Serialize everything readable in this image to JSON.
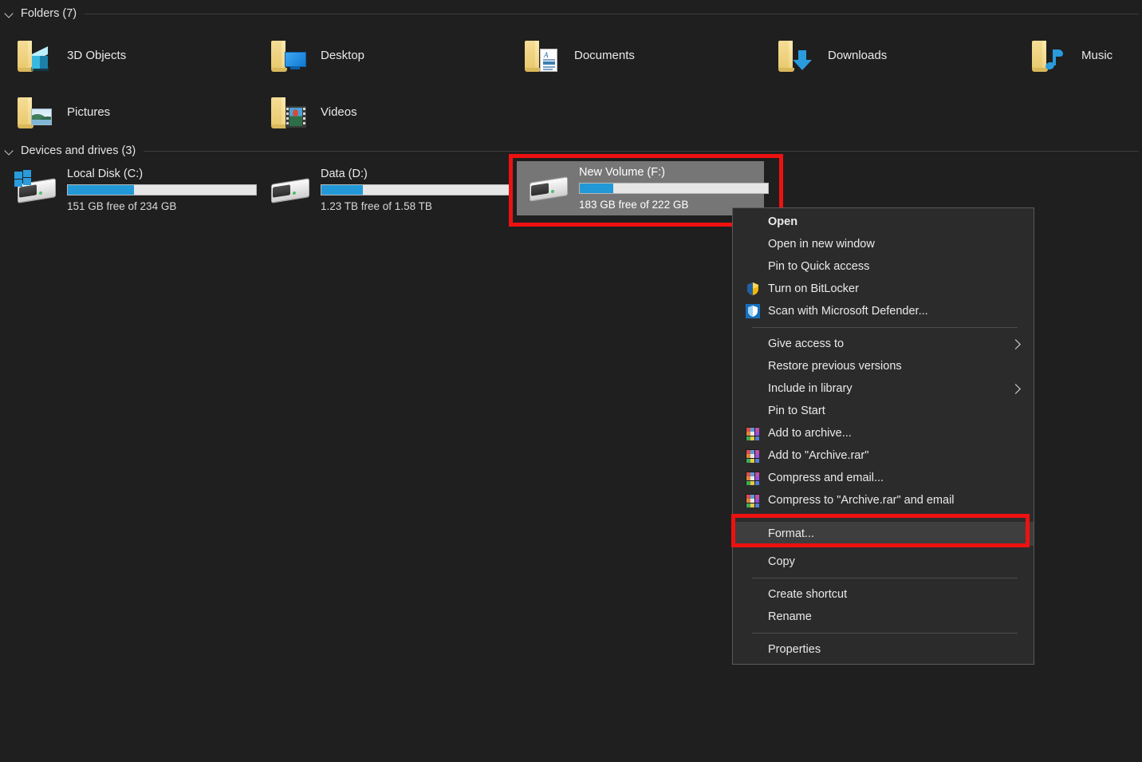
{
  "window": {
    "background_color": "#1f1f1f",
    "accent_color": "#2398d6",
    "annotation_color": "#ee1111"
  },
  "sections": [
    {
      "id": "folders",
      "title": "Folders (7)",
      "chevron_icon": "chevron-down-icon"
    },
    {
      "id": "devices",
      "title": "Devices and drives (3)",
      "chevron_icon": "chevron-down-icon"
    }
  ],
  "folders": [
    {
      "label": "3D Objects",
      "icon": "folder-3d-objects-icon"
    },
    {
      "label": "Desktop",
      "icon": "folder-desktop-icon"
    },
    {
      "label": "Documents",
      "icon": "folder-documents-icon"
    },
    {
      "label": "Downloads",
      "icon": "folder-downloads-icon"
    },
    {
      "label": "Music",
      "icon": "folder-music-icon"
    },
    {
      "label": "Pictures",
      "icon": "folder-pictures-icon"
    },
    {
      "label": "Videos",
      "icon": "folder-videos-icon"
    }
  ],
  "drives": [
    {
      "name": "Local Disk (C:)",
      "free_text": "151 GB free of 234 GB",
      "used_percent": 35,
      "icon": "hard-drive-windows-icon",
      "selected": false
    },
    {
      "name": "Data (D:)",
      "free_text": "1.23 TB free of 1.58 TB",
      "used_percent": 22,
      "icon": "hard-drive-icon",
      "selected": false
    },
    {
      "name": "New Volume (F:)",
      "free_text": "183 GB free of 222 GB",
      "used_percent": 18,
      "icon": "hard-drive-icon",
      "selected": true
    }
  ],
  "context_menu": {
    "items": [
      {
        "type": "item",
        "label": "Open",
        "bold": true,
        "icon": null,
        "submenu": false,
        "highlighted": false
      },
      {
        "type": "item",
        "label": "Open in new window",
        "bold": false,
        "icon": null,
        "submenu": false,
        "highlighted": false
      },
      {
        "type": "item",
        "label": "Pin to Quick access",
        "bold": false,
        "icon": null,
        "submenu": false,
        "highlighted": false
      },
      {
        "type": "item",
        "label": "Turn on BitLocker",
        "bold": false,
        "icon": "bitlocker-shield-icon",
        "submenu": false,
        "highlighted": false
      },
      {
        "type": "item",
        "label": "Scan with Microsoft Defender...",
        "bold": false,
        "icon": "defender-shield-icon",
        "submenu": false,
        "highlighted": false
      },
      {
        "type": "separator"
      },
      {
        "type": "item",
        "label": "Give access to",
        "bold": false,
        "icon": null,
        "submenu": true,
        "highlighted": false
      },
      {
        "type": "item",
        "label": "Restore previous versions",
        "bold": false,
        "icon": null,
        "submenu": false,
        "highlighted": false
      },
      {
        "type": "item",
        "label": "Include in library",
        "bold": false,
        "icon": null,
        "submenu": true,
        "highlighted": false
      },
      {
        "type": "item",
        "label": "Pin to Start",
        "bold": false,
        "icon": null,
        "submenu": false,
        "highlighted": false
      },
      {
        "type": "item",
        "label": "Add to archive...",
        "bold": false,
        "icon": "winrar-icon",
        "submenu": false,
        "highlighted": false
      },
      {
        "type": "item",
        "label": "Add to \"Archive.rar\"",
        "bold": false,
        "icon": "winrar-icon",
        "submenu": false,
        "highlighted": false
      },
      {
        "type": "item",
        "label": "Compress and email...",
        "bold": false,
        "icon": "winrar-icon",
        "submenu": false,
        "highlighted": false
      },
      {
        "type": "item",
        "label": "Compress to \"Archive.rar\" and email",
        "bold": false,
        "icon": "winrar-icon",
        "submenu": false,
        "highlighted": false
      },
      {
        "type": "separator"
      },
      {
        "type": "item",
        "label": "Format...",
        "bold": false,
        "icon": null,
        "submenu": false,
        "highlighted": true
      },
      {
        "type": "item",
        "label": "Copy",
        "bold": false,
        "icon": null,
        "submenu": false,
        "highlighted": false
      },
      {
        "type": "separator"
      },
      {
        "type": "item",
        "label": "Create shortcut",
        "bold": false,
        "icon": null,
        "submenu": false,
        "highlighted": false
      },
      {
        "type": "item",
        "label": "Rename",
        "bold": false,
        "icon": null,
        "submenu": false,
        "highlighted": false
      },
      {
        "type": "separator"
      },
      {
        "type": "item",
        "label": "Properties",
        "bold": false,
        "icon": null,
        "submenu": false,
        "highlighted": false
      }
    ]
  },
  "annotations": [
    {
      "id": "highlight-new-volume-drive",
      "target": "New Volume (F:)"
    },
    {
      "id": "highlight-format-menu-item",
      "target": "Format..."
    }
  ]
}
